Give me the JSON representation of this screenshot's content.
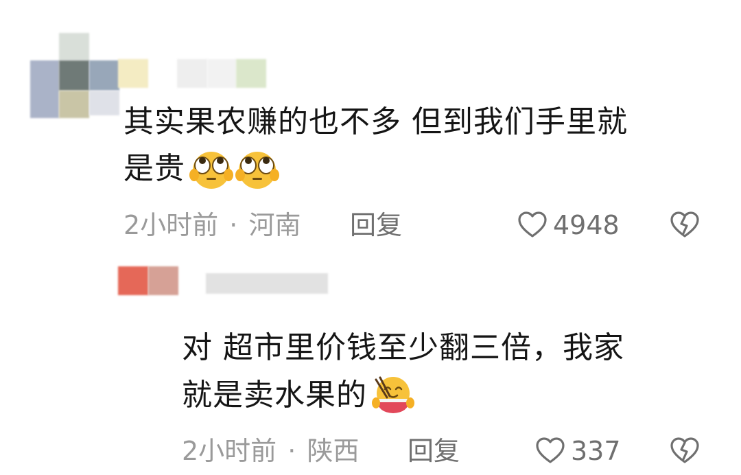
{
  "comments": [
    {
      "lines": [
        "其实果农赚的也不多 但到我们手里就",
        "是贵"
      ],
      "emoji": [
        "eye-roll-emoji",
        "eye-roll-emoji"
      ],
      "time": "2小时前",
      "separator": "·",
      "location": "河南",
      "reply_label": "回复",
      "likes": "4948"
    },
    {
      "lines": [
        "对 超市里价钱至少翻三倍，我家",
        "就是卖水果的"
      ],
      "emoji": [
        "eating-noodles-emoji"
      ],
      "time": "2小时前",
      "separator": "·",
      "location": "陕西",
      "reply_label": "回复",
      "likes": "337"
    }
  ],
  "icons": {
    "like": "heart-outline-icon",
    "dislike": "broken-heart-icon"
  },
  "colors": {
    "text": "#151515",
    "meta": "#9a9a9a",
    "action": "#6f6f6f",
    "emoji_yellow": "#f7c23a"
  }
}
